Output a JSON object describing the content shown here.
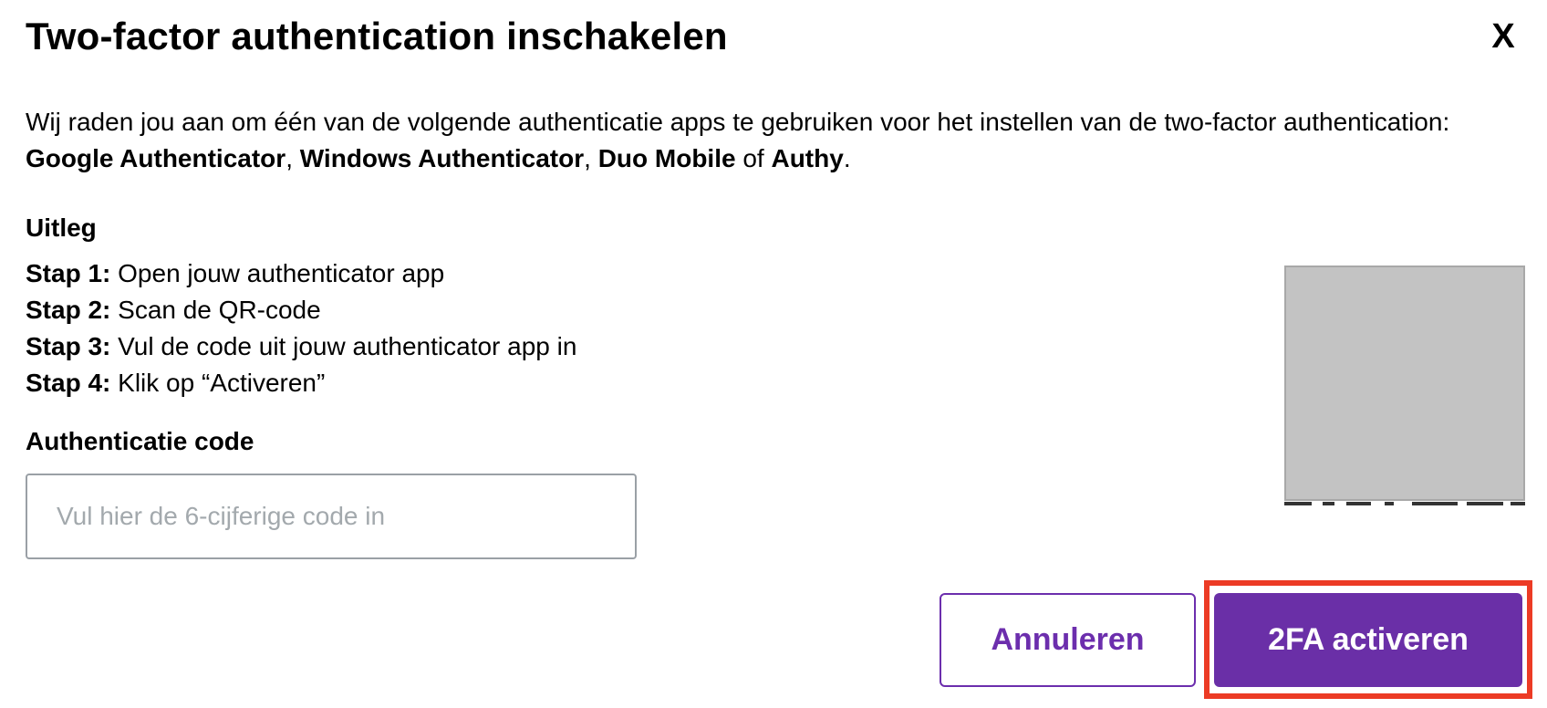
{
  "dialog": {
    "title": "Two-factor authentication inschakelen",
    "close_label": "X"
  },
  "intro": {
    "text_before": "Wij raden jou aan om één van de volgende authenticatie apps te gebruiken voor het instellen van de two-factor authentication: ",
    "apps": [
      "Google Authenticator",
      "Windows Authenticator",
      "Duo Mobile",
      "Authy"
    ],
    "separator_1": ", ",
    "separator_2": ", ",
    "separator_3": " of ",
    "ending": "."
  },
  "instructions": {
    "heading": "Uitleg",
    "steps": [
      {
        "label": "Stap 1:",
        "text": " Open jouw authenticator app"
      },
      {
        "label": "Stap 2:",
        "text": " Scan de QR-code"
      },
      {
        "label": "Stap 3:",
        "text": " Vul de code uit jouw authenticator app in"
      },
      {
        "label": "Stap 4:",
        "text": " Klik op “Activeren”"
      }
    ]
  },
  "code": {
    "label": "Authenticatie code",
    "value": "",
    "placeholder": "Vul hier de 6-cijferige code in"
  },
  "qr": {
    "icon": "qr-code-icon",
    "placeholder_color": "#c3c3c3"
  },
  "actions": {
    "cancel_label": "Annuleren",
    "activate_label": "2FA activeren",
    "highlight_color": "#ec3b25"
  },
  "colors": {
    "accent": "#6a2fa7",
    "accent_border": "#6c2ead",
    "placeholder_text": "#a3a9ad"
  }
}
